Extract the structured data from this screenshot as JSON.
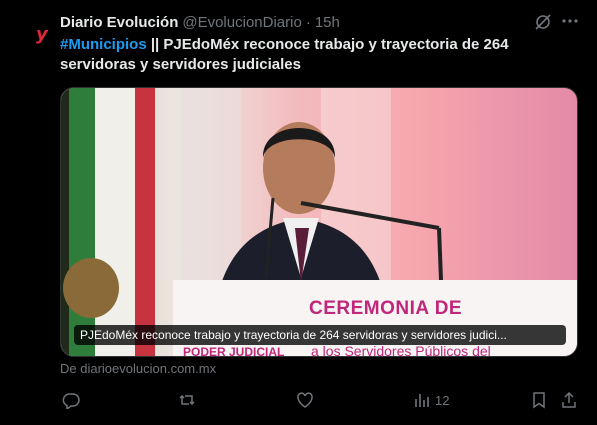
{
  "tweet": {
    "author_name": "Diario Evolución",
    "handle": "@EvolucionDiario",
    "separator": "·",
    "time": "15h",
    "hashtag": "#Municipios",
    "text": " || PJEdoMéx reconoce trabajo y trayectoria de 264 servidoras y servidores judiciales",
    "avatar_glyph": "y",
    "media_caption": "PJEdoMéx reconoce trabajo y trayectoria de 264 servidoras y servidores judici...",
    "banner_line1": "CEREMONIA DE",
    "banner_line2": "a los Servidores Públicos del",
    "banner_org": "PODER JUDICIAL",
    "source": "De diarioevolucion.com.mx",
    "views": "12"
  },
  "icons": [
    "grok-icon",
    "more-icon",
    "reply-icon",
    "retweet-icon",
    "like-icon",
    "views-icon",
    "bookmark-icon",
    "share-icon"
  ],
  "colors": {
    "background": "#000000",
    "text": "#e7e9ea",
    "muted": "#71767b",
    "link": "#1d9bf0",
    "brand": "#e0263a"
  }
}
